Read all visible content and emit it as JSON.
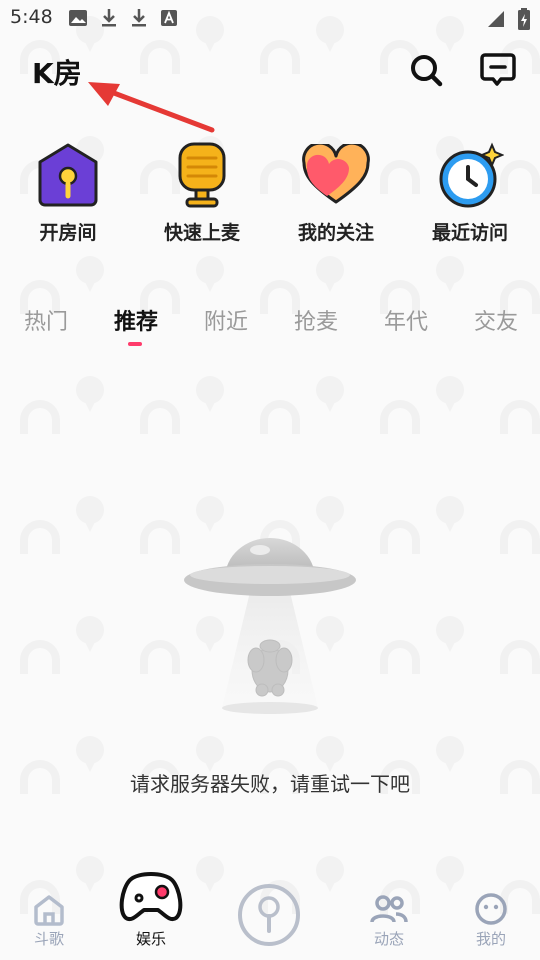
{
  "status_bar": {
    "time": "5:48",
    "left_icons": [
      "image-icon",
      "download-icon",
      "download-icon",
      "font-icon"
    ],
    "right_icons": [
      "signal-icon",
      "battery-icon"
    ]
  },
  "header": {
    "title": "K房",
    "search_icon": "search-icon",
    "message_icon": "message-icon"
  },
  "shortcuts": [
    {
      "label": "开房间",
      "icon": "house-mic-icon",
      "color": "#6b3fd6"
    },
    {
      "label": "快速上麦",
      "icon": "microphone-icon",
      "color": "#f5b21a"
    },
    {
      "label": "我的关注",
      "icon": "heart-icon",
      "color": "#ff6b6b"
    },
    {
      "label": "最近访问",
      "icon": "clock-icon",
      "color": "#2d9cf0"
    }
  ],
  "tabs": [
    {
      "label": "热门",
      "active": false
    },
    {
      "label": "推荐",
      "active": true
    },
    {
      "label": "附近",
      "active": false
    },
    {
      "label": "抢麦",
      "active": false
    },
    {
      "label": "年代",
      "active": false
    },
    {
      "label": "交友",
      "active": false
    }
  ],
  "empty_state": {
    "message": "请求服务器失败，请重试一下吧",
    "illustration": "ufo-illustration"
  },
  "bottom_nav": [
    {
      "label": "斗歌",
      "icon": "house-icon",
      "active": false
    },
    {
      "label": "娱乐",
      "icon": "gamepad-icon",
      "active": true
    },
    {
      "label": "",
      "icon": "microphone-icon",
      "active": false
    },
    {
      "label": "动态",
      "icon": "people-icon",
      "active": false
    },
    {
      "label": "我的",
      "icon": "face-icon",
      "active": false
    }
  ],
  "colors": {
    "accent": "#ff3b6b",
    "annotation_arrow": "#e53935",
    "inactive_nav": "#9aa4b8"
  }
}
